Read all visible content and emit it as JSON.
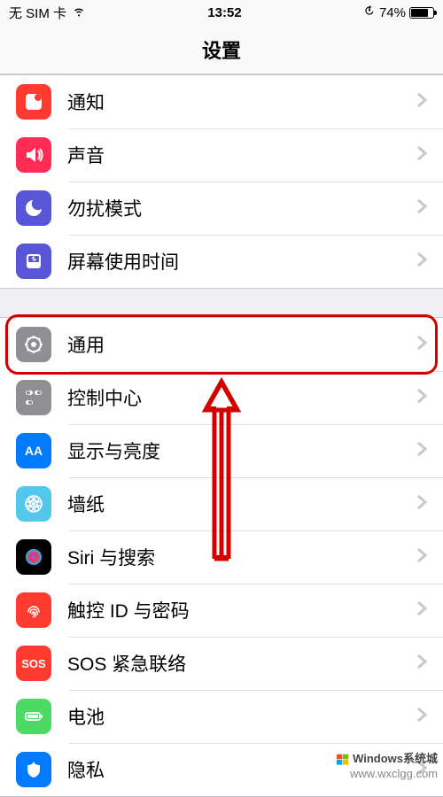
{
  "status": {
    "carrier": "无 SIM 卡",
    "time": "13:52",
    "battery_pct": "74%"
  },
  "nav": {
    "title": "设置"
  },
  "group1": [
    {
      "name": "notifications",
      "label": "通知",
      "bg": "#ff3b30",
      "icon": "notifications"
    },
    {
      "name": "sounds",
      "label": "声音",
      "bg": "#ff2d55",
      "icon": "sounds"
    },
    {
      "name": "dnd",
      "label": "勿扰模式",
      "bg": "#5856d6",
      "icon": "dnd"
    },
    {
      "name": "screentime",
      "label": "屏幕使用时间",
      "bg": "#5856d6",
      "icon": "screentime"
    }
  ],
  "group2": [
    {
      "name": "general",
      "label": "通用",
      "bg": "#8e8e93",
      "icon": "general"
    },
    {
      "name": "control-center",
      "label": "控制中心",
      "bg": "#8e8e93",
      "icon": "control-center"
    },
    {
      "name": "display",
      "label": "显示与亮度",
      "bg": "#007aff",
      "icon": "display"
    },
    {
      "name": "wallpaper",
      "label": "墙纸",
      "bg": "#54c7ec",
      "icon": "wallpaper"
    },
    {
      "name": "siri",
      "label": "Siri 与搜索",
      "bg": "#000000",
      "icon": "siri"
    },
    {
      "name": "touchid",
      "label": "触控 ID 与密码",
      "bg": "#ff3b30",
      "icon": "touchid"
    },
    {
      "name": "sos",
      "label": "SOS 紧急联络",
      "bg": "#ff3b30",
      "icon": "sos",
      "text_icon": "SOS"
    },
    {
      "name": "battery",
      "label": "电池",
      "bg": "#4cd964",
      "icon": "battery"
    },
    {
      "name": "privacy",
      "label": "隐私",
      "bg": "#007aff",
      "icon": "privacy"
    }
  ],
  "annotation": {
    "highlighted_row": "general"
  },
  "watermark": {
    "brand": "Windows系统城",
    "url": "www.wxclgg.com"
  }
}
